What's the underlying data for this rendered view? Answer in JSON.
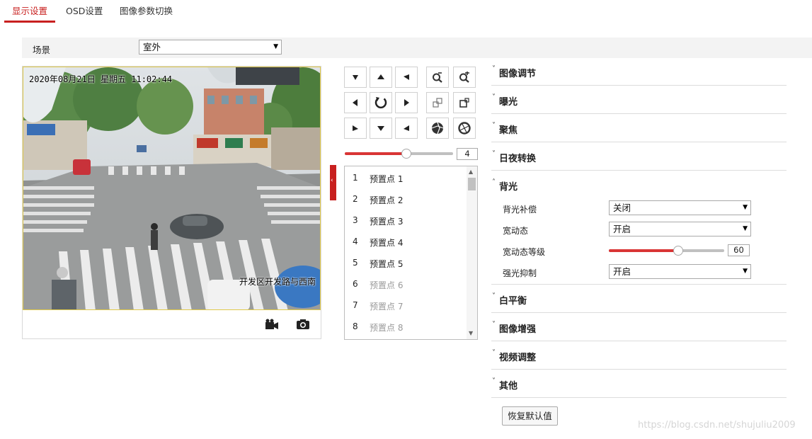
{
  "tabs": [
    "显示设置",
    "OSD设置",
    "图像参数切换"
  ],
  "scene": {
    "label": "场景",
    "value": "室外"
  },
  "video": {
    "osd_time": "2020年08月21日 星期五 11:02:44",
    "osd_name": "开发区开发路与西南"
  },
  "ptz": {
    "speed": 4,
    "speed_max": 7
  },
  "presets": [
    {
      "num": "1",
      "name": "预置点 1",
      "enabled": true
    },
    {
      "num": "2",
      "name": "预置点 2",
      "enabled": true
    },
    {
      "num": "3",
      "name": "预置点 3",
      "enabled": true
    },
    {
      "num": "4",
      "name": "预置点 4",
      "enabled": true
    },
    {
      "num": "5",
      "name": "预置点 5",
      "enabled": true
    },
    {
      "num": "6",
      "name": "预置点 6",
      "enabled": false
    },
    {
      "num": "7",
      "name": "预置点 7",
      "enabled": false
    },
    {
      "num": "8",
      "name": "预置点 8",
      "enabled": false
    }
  ],
  "sections": [
    {
      "title": "图像调节",
      "expanded": false
    },
    {
      "title": "曝光",
      "expanded": false
    },
    {
      "title": "聚焦",
      "expanded": false
    },
    {
      "title": "日夜转换",
      "expanded": false
    },
    {
      "title": "背光",
      "expanded": true
    },
    {
      "title": "白平衡",
      "expanded": false
    },
    {
      "title": "图像增强",
      "expanded": false
    },
    {
      "title": "视频调整",
      "expanded": false
    },
    {
      "title": "其他",
      "expanded": false
    }
  ],
  "backlight": {
    "blc_label": "背光补偿",
    "blc_value": "关闭",
    "wdr_label": "宽动态",
    "wdr_value": "开启",
    "wdr_level_label": "宽动态等级",
    "wdr_level": 60,
    "wdr_level_max": 100,
    "hlc_label": "强光抑制",
    "hlc_value": "开启"
  },
  "reset_label": "恢复默认值",
  "watermark": "https://blog.csdn.net/shujuliu2009",
  "colors": {
    "accent": "#c8201f",
    "slider_fill": "#d93535",
    "disabled_text": "#9a9a9a"
  }
}
